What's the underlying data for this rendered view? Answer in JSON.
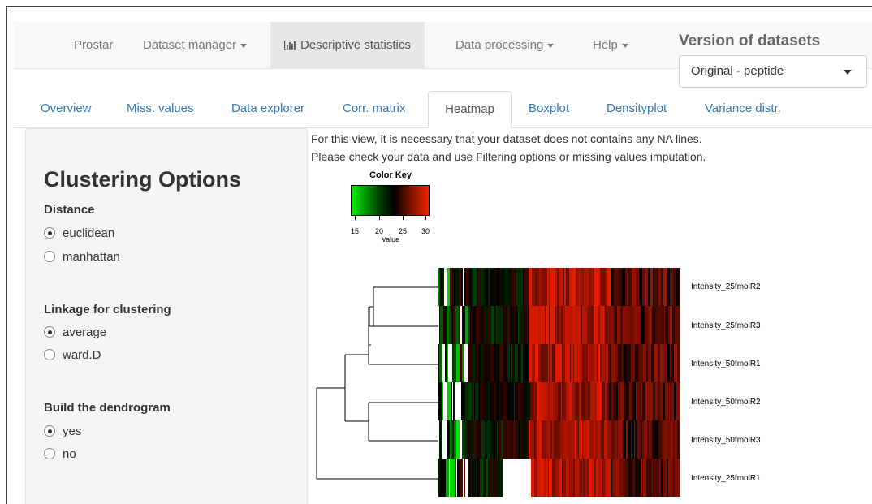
{
  "navbar": {
    "items": [
      {
        "label": "Prostar"
      },
      {
        "label": "Dataset manager"
      },
      {
        "label": "Descriptive statistics"
      },
      {
        "label": "Data processing"
      },
      {
        "label": "Help"
      }
    ],
    "active_index": 2,
    "version_title": "Version of datasets",
    "version_selected": "Original - peptide"
  },
  "tabs": [
    {
      "label": "Overview"
    },
    {
      "label": "Miss. values"
    },
    {
      "label": "Data explorer"
    },
    {
      "label": "Corr. matrix"
    },
    {
      "label": "Heatmap"
    },
    {
      "label": "Boxplot"
    },
    {
      "label": "Densityplot"
    },
    {
      "label": "Variance distr."
    }
  ],
  "active_tab": "Heatmap",
  "sidebar": {
    "title": "Clustering Options",
    "distance": {
      "label": "Distance",
      "options": [
        "euclidean",
        "manhattan"
      ],
      "selected": "euclidean"
    },
    "linkage": {
      "label": "Linkage for clustering",
      "options": [
        "average",
        "ward.D"
      ],
      "selected": "average"
    },
    "dendrogram": {
      "label": "Build the dendrogram",
      "options": [
        "yes",
        "no"
      ],
      "selected": "yes"
    }
  },
  "message": {
    "line1": "For this view, it is necessary that your dataset does not contains any NA lines.",
    "line2": "Please check your data and use Filtering options or missing values imputation."
  },
  "color_key": {
    "title": "Color Key",
    "ticks": [
      "15",
      "20",
      "25",
      "30"
    ],
    "xlabel": "Value"
  },
  "heatmap": {
    "rows": [
      "Intensity_25fmolR2",
      "Intensity_25fmolR3",
      "Intensity_50fmolR1",
      "Intensity_50fmolR2",
      "Intensity_50fmolR3",
      "Intensity_25fmolR1"
    ]
  },
  "colors": {
    "link": "#337ab7",
    "low": "#00ee00",
    "mid": "#000000",
    "high": "#ee2200"
  }
}
